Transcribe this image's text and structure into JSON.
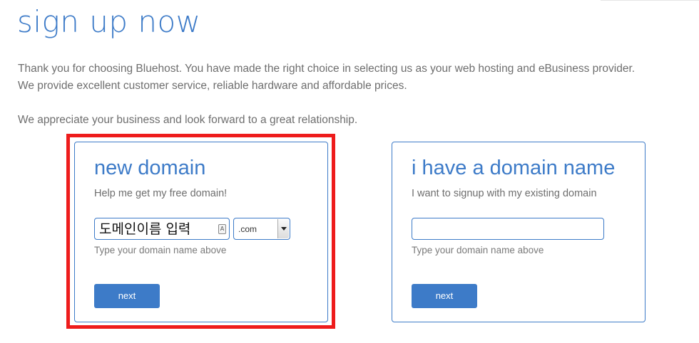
{
  "page": {
    "title": "sign up now",
    "intro_line1": "Thank you for choosing Bluehost. You have made the right choice in selecting us as your web hosting and eBusiness provider.",
    "intro_line2": "We provide excellent customer service, reliable hardware and affordable prices.",
    "intro_line3": "We appreciate your business and look forward to a great relationship."
  },
  "new_domain": {
    "title": "new domain",
    "subtitle": "Help me get my free domain!",
    "input_value": "도메인이름 입력",
    "tld_selected": ".com",
    "hint": "Type your domain name above",
    "next_label": "next"
  },
  "existing_domain": {
    "title": "i have a domain name",
    "subtitle": "I want to signup with my existing domain",
    "input_value": "",
    "hint": "Type your domain name above",
    "next_label": "next"
  },
  "colors": {
    "accent": "#3d7bc8",
    "highlight": "#ee1c1c"
  },
  "icons": {
    "ime": "ime-indicator-icon",
    "dropdown": "chevron-down-icon"
  }
}
